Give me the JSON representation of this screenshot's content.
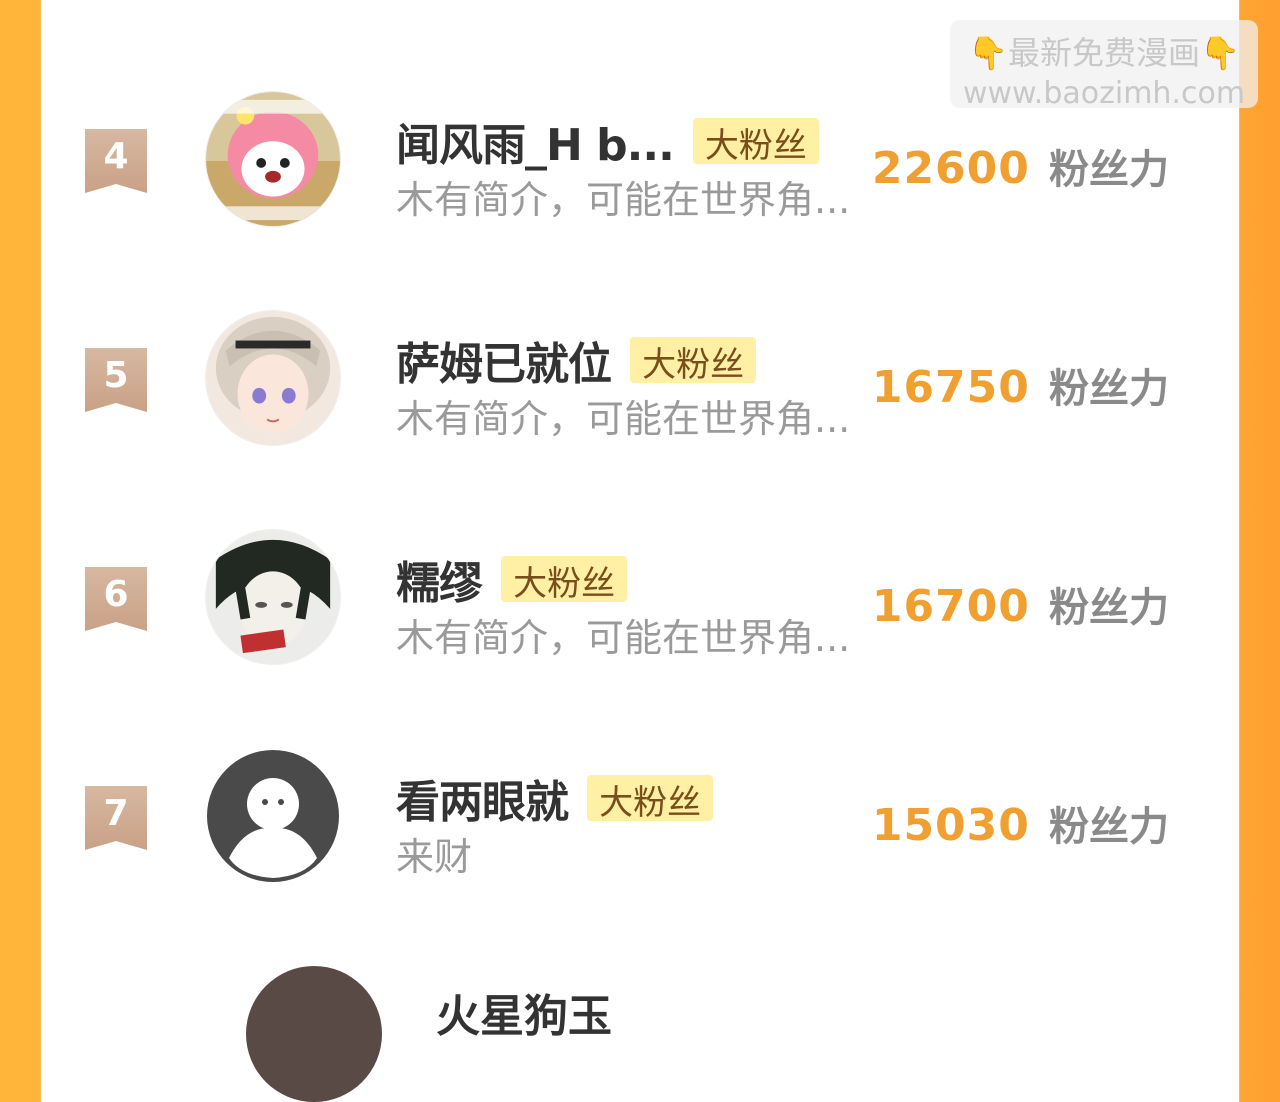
{
  "watermark": {
    "line1": "👇最新免费漫画👇",
    "line2": "www.baozimh.com"
  },
  "badge_label": "大粉丝",
  "unit_label": "粉丝力",
  "rows": [
    {
      "rank": "4",
      "name": "闻风雨_H b...",
      "bio": "木有简介，可能在世界角...",
      "score": "22600"
    },
    {
      "rank": "5",
      "name": "萨姆已就位",
      "bio": "木有简介，可能在世界角...",
      "score": "16750"
    },
    {
      "rank": "6",
      "name": "糯缪",
      "bio": "木有简介，可能在世界角...",
      "score": "16700"
    },
    {
      "rank": "7",
      "name": "看两眼就",
      "bio": "来财",
      "score": "15030"
    }
  ],
  "partial_next": {
    "name": "火星狗玉"
  },
  "colors": {
    "accent_orange": "#f0a030",
    "badge_bg": "#fff0a6",
    "rank_ribbon": "#c9a186"
  }
}
